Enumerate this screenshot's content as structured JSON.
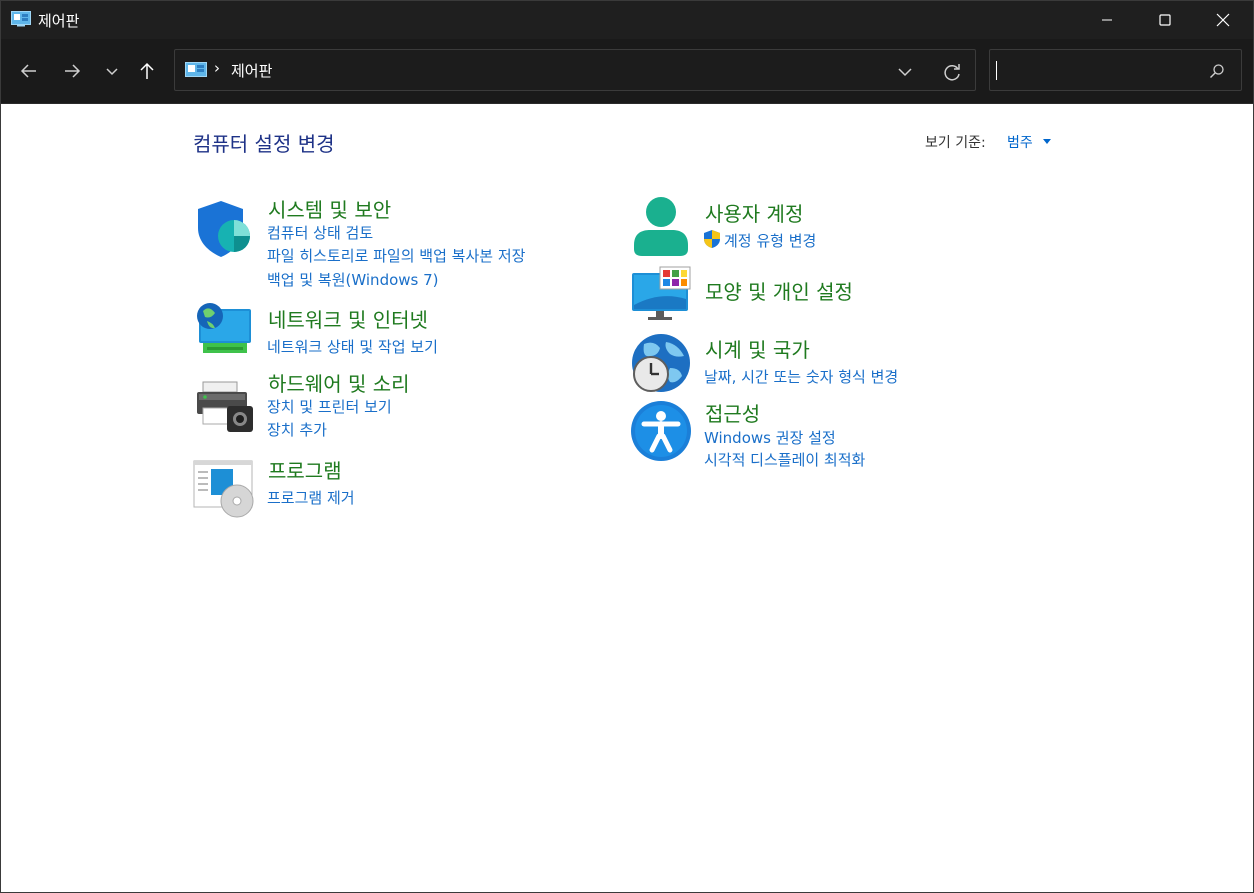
{
  "window": {
    "title": "제어판"
  },
  "address": {
    "path": "제어판",
    "separator": "›"
  },
  "search": {
    "value": "",
    "placeholder": ""
  },
  "header": {
    "title": "컴퓨터 설정 변경",
    "view_by_label": "보기 기준:",
    "view_by_value": "범주"
  },
  "categories": [
    {
      "title": "시스템 및 보안",
      "icon": "shield-icon",
      "links": [
        "컴퓨터 상태 검토",
        "파일 히스토리로 파일의 백업 복사본 저장",
        "백업 및 복원(Windows 7)"
      ]
    },
    {
      "title": "네트워크 및 인터넷",
      "icon": "network-icon",
      "links": [
        "네트워크 상태 및 작업 보기"
      ]
    },
    {
      "title": "하드웨어 및 소리",
      "icon": "printer-icon",
      "links": [
        "장치 및 프린터 보기",
        "장치 추가"
      ]
    },
    {
      "title": "프로그램",
      "icon": "programs-icon",
      "links": [
        "프로그램 제거"
      ]
    },
    {
      "title": "사용자 계정",
      "icon": "user-icon",
      "links": [
        "계정 유형 변경"
      ]
    },
    {
      "title": "모양 및 개인 설정",
      "icon": "monitor-icon",
      "links": []
    },
    {
      "title": "시계 및 국가",
      "icon": "clock-globe-icon",
      "links": [
        "날짜, 시간 또는 숫자 형식 변경"
      ]
    },
    {
      "title": "접근성",
      "icon": "accessibility-icon",
      "links": [
        "Windows 권장 설정",
        "시각적 디스플레이 최적화"
      ]
    }
  ],
  "colors": {
    "titlebar": "#1f1f1f",
    "category_title": "#1f7a1f",
    "link": "#1a6fc9",
    "page_title": "#1e3287"
  }
}
